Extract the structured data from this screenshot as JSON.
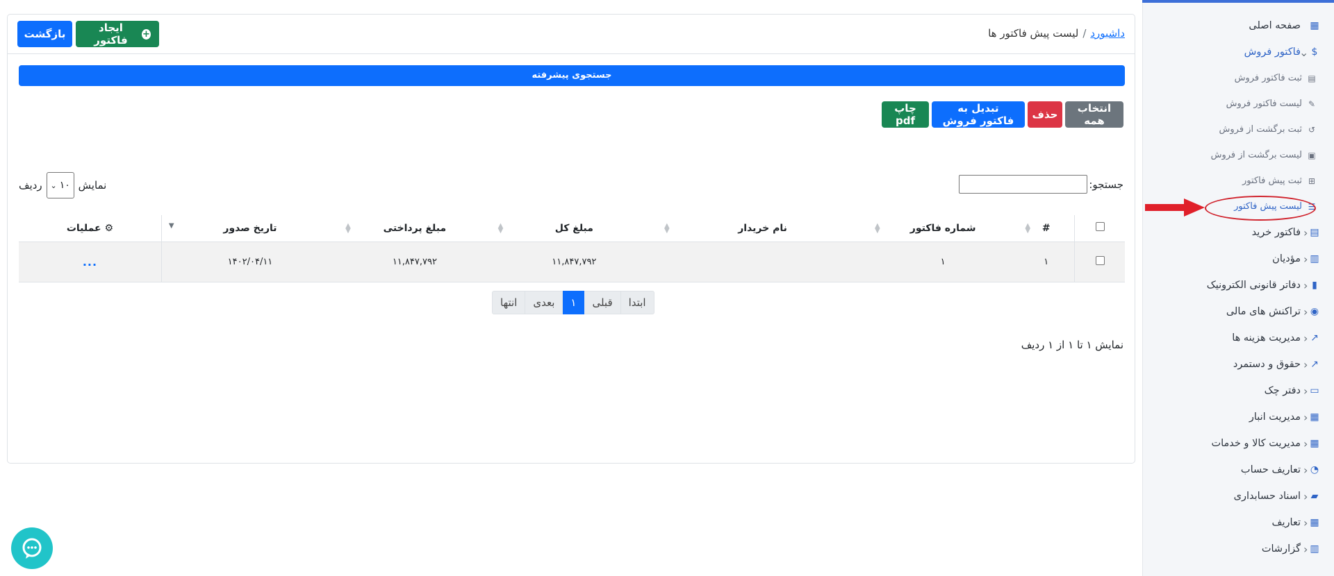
{
  "sidebar": {
    "items": [
      {
        "label": "صفحه اصلی",
        "icon": "dashboard-icon",
        "glyph": "▦"
      },
      {
        "label": "فاکتور فروش",
        "icon": "invoice-icon",
        "glyph": "$",
        "open": true,
        "children": [
          {
            "label": "ثبت فاکتور فروش",
            "icon": "document-icon",
            "glyph": "▤"
          },
          {
            "label": "لیست فاکتور فروش",
            "icon": "scroll-icon",
            "glyph": "✎"
          },
          {
            "label": "ثبت برگشت از فروش",
            "icon": "undo-icon",
            "glyph": "↺"
          },
          {
            "label": "لیست برگشت از فروش",
            "icon": "clipboard-icon",
            "glyph": "▣"
          },
          {
            "label": "ثبت پیش فاکتور",
            "icon": "plus-square-icon",
            "glyph": "⊞"
          },
          {
            "label": "لیست پیش فاکتور",
            "icon": "list-icon",
            "glyph": "☰",
            "active": true
          }
        ]
      },
      {
        "label": "فاکتور خرید",
        "icon": "invoice-buy-icon",
        "glyph": "▤"
      },
      {
        "label": "مؤدیان",
        "icon": "bar-chart-icon",
        "glyph": "▥"
      },
      {
        "label": "دفاتر قانونی الکترونیک",
        "icon": "book-icon",
        "glyph": "▮"
      },
      {
        "label": "تراکنش های مالی",
        "icon": "coins-icon",
        "glyph": "◉"
      },
      {
        "label": "مدیریت هزینه ها",
        "icon": "line-chart-icon",
        "glyph": "↗"
      },
      {
        "label": "حقوق و دستمرد",
        "icon": "line-chart-icon",
        "glyph": "↗"
      },
      {
        "label": "دفتر چک",
        "icon": "money-bill-icon",
        "glyph": "▭"
      },
      {
        "label": "مدیریت انبار",
        "icon": "warehouse-icon",
        "glyph": "▦"
      },
      {
        "label": "مدیریت کالا و خدمات",
        "icon": "table-icon",
        "glyph": "▦"
      },
      {
        "label": "تعاریف حساب",
        "icon": "pie-chart-icon",
        "glyph": "◔"
      },
      {
        "label": "اسناد حسابداری",
        "icon": "folder-open-icon",
        "glyph": "▰"
      },
      {
        "label": "تعاریف",
        "icon": "table-icon",
        "glyph": "▦"
      },
      {
        "label": "گزارشات",
        "icon": "chart-area-icon",
        "glyph": "▥"
      }
    ]
  },
  "header": {
    "breadcrumb_link": "داشبورد",
    "breadcrumb_sep": "/",
    "breadcrumb_current": "لیست پیش فاکتور ها",
    "create_label": "ایجاد فاکتور",
    "back_label": "بازگشت"
  },
  "advanced_search_label": "جستجوی پیشرفته",
  "actions": {
    "select_all": "انتخاب همه",
    "delete": "حذف",
    "convert": "تبدیل به فاکتور فروش",
    "print_pdf": "چاپ pdf"
  },
  "search": {
    "label": "جستجو:",
    "value": ""
  },
  "length": {
    "prefix": "نمایش",
    "value": "۱۰",
    "suffix": "ردیف"
  },
  "table": {
    "columns": [
      "#",
      "شماره فاکتور",
      "نام خریدار",
      "مبلغ کل",
      "مبلغ پرداختی",
      "تاریخ صدور",
      "عملیات"
    ],
    "rows": [
      {
        "index": "۱",
        "invoice_no": "۱",
        "buyer": "",
        "total": "۱۱,۸۴۷,۷۹۲",
        "paid": "۱۱,۸۴۷,۷۹۲",
        "date": "۱۴۰۲/۰۴/۱۱",
        "ops": "..."
      }
    ]
  },
  "pagination": {
    "first": "ابتدا",
    "prev": "قبلی",
    "current": "۱",
    "next": "بعدی",
    "last": "انتها"
  },
  "info": "نمایش ۱ تا ۱ از ۱ ردیف",
  "colors": {
    "primary": "#0d6efd",
    "success": "#198754",
    "danger": "#dc3545",
    "secondary": "#6c757d",
    "chat": "#21c4c9",
    "annotation": "#d0212b"
  }
}
